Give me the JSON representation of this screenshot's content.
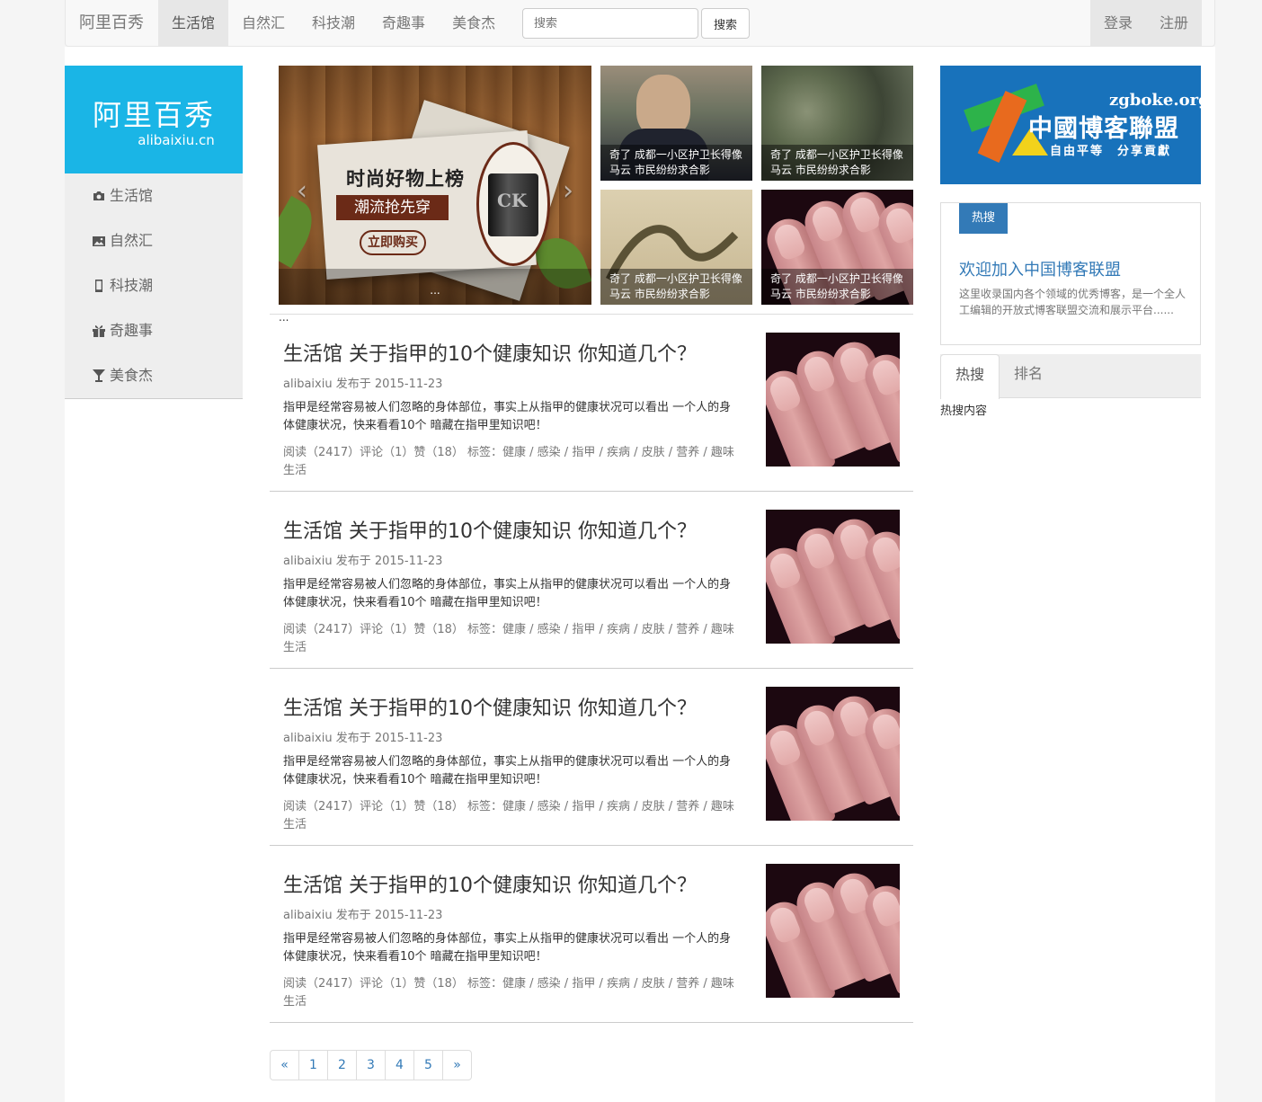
{
  "navbar": {
    "brand": "阿里百秀",
    "links": [
      "生活馆",
      "自然汇",
      "科技潮",
      "奇趣事",
      "美食杰"
    ],
    "search_placeholder": "搜索",
    "search_button": "搜索",
    "login": "登录",
    "register": "注册"
  },
  "sidebar": {
    "logo_cn": "阿里百秀",
    "logo_en": "alibaixiu.cn",
    "items": [
      {
        "label": "生活馆",
        "icon": "camera-icon"
      },
      {
        "label": "自然汇",
        "icon": "picture-icon"
      },
      {
        "label": "科技潮",
        "icon": "phone-icon"
      },
      {
        "label": "奇趣事",
        "icon": "gift-icon"
      },
      {
        "label": "美食杰",
        "icon": "glass-icon"
      }
    ]
  },
  "carousel": {
    "ad_line1": "时尚好物上榜",
    "ad_line2": "潮流抢先穿",
    "ad_button": "立即购买",
    "caption": "...",
    "prev": "‹",
    "next": "›"
  },
  "thumbs": [
    {
      "caption": "奇了 成都一小区护卫长得像马云 市民纷纷求合影"
    },
    {
      "caption": "奇了 成都一小区护卫长得像马云 市民纷纷求合影"
    },
    {
      "caption": "奇了 成都一小区护卫长得像马云 市民纷纷求合影"
    },
    {
      "caption": "奇了 成都一小区护卫长得像马云 市民纷纷求合影"
    }
  ],
  "separator_dots": "...",
  "articles": [
    {
      "title": "生活馆 关于指甲的10个健康知识 你知道几个？",
      "meta": "alibaixiu 发布于 2015-11-23",
      "desc": "指甲是经常容易被人们忽略的身体部位，事实上从指甲的健康状况可以看出 一个人的身体健康状况，快来看看10个 暗藏在指甲里知识吧！",
      "stats": "阅读（2417）评论（1）赞（18） 标签：健康 / 感染 / 指甲 / 疾病 / 皮肤 / 营养 / 趣味生活"
    },
    {
      "title": "生活馆 关于指甲的10个健康知识 你知道几个？",
      "meta": "alibaixiu 发布于 2015-11-23",
      "desc": "指甲是经常容易被人们忽略的身体部位，事实上从指甲的健康状况可以看出 一个人的身体健康状况，快来看看10个 暗藏在指甲里知识吧！",
      "stats": "阅读（2417）评论（1）赞（18） 标签：健康 / 感染 / 指甲 / 疾病 / 皮肤 / 营养 / 趣味生活"
    },
    {
      "title": "生活馆 关于指甲的10个健康知识 你知道几个？",
      "meta": "alibaixiu 发布于 2015-11-23",
      "desc": "指甲是经常容易被人们忽略的身体部位，事实上从指甲的健康状况可以看出 一个人的身体健康状况，快来看看10个 暗藏在指甲里知识吧！",
      "stats": "阅读（2417）评论（1）赞（18） 标签：健康 / 感染 / 指甲 / 疾病 / 皮肤 / 营养 / 趣味生活"
    },
    {
      "title": "生活馆 关于指甲的10个健康知识 你知道几个？",
      "meta": "alibaixiu 发布于 2015-11-23",
      "desc": "指甲是经常容易被人们忽略的身体部位，事实上从指甲的健康状况可以看出 一个人的身体健康状况，快来看看10个 暗藏在指甲里知识吧！",
      "stats": "阅读（2417）评论（1）赞（18） 标签：健康 / 感染 / 指甲 / 疾病 / 皮肤 / 营养 / 趣味生活"
    }
  ],
  "pagination": [
    "«",
    "1",
    "2",
    "3",
    "4",
    "5",
    "»"
  ],
  "banner": {
    "url": "zgboke.org",
    "name": "中國博客聯盟",
    "slogan": "自由平等　分享貢獻"
  },
  "panel": {
    "badge": "热搜",
    "title": "欢迎加入中国博客联盟",
    "text": "这里收录国内各个领域的优秀博客，是一个全人工编辑的开放式博客联盟交流和展示平台......"
  },
  "tabs": {
    "items": [
      "热搜",
      "排名"
    ],
    "content": "热搜内容"
  },
  "colors": {
    "accent": "#337ab7",
    "logo_bg": "#1ab5e6",
    "banner_bg": "#1872bb"
  }
}
